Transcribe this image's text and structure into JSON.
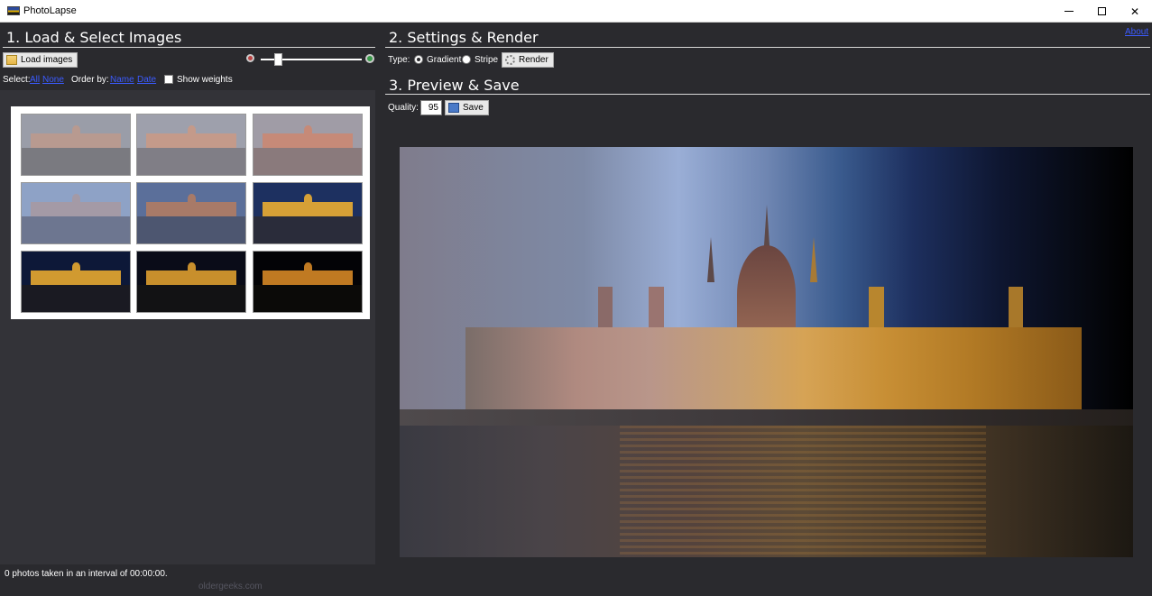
{
  "window": {
    "title": "PhotoLapse"
  },
  "sections": {
    "load": {
      "title": "1. Load & Select Images"
    },
    "settings": {
      "title": "2. Settings & Render"
    },
    "preview": {
      "title": "3. Preview & Save"
    }
  },
  "about_link": "About",
  "load_panel": {
    "load_button": "Load images",
    "select_label": "Select:",
    "select_all": "All",
    "select_none": "None",
    "order_label": "Order by:",
    "order_name": "Name",
    "order_date": "Date",
    "show_weights_label": "Show weights",
    "show_weights_checked": false
  },
  "settings_panel": {
    "type_label": "Type:",
    "options": [
      "Gradient",
      "Stripe"
    ],
    "selected": "Gradient",
    "render_button": "Render"
  },
  "preview_panel": {
    "quality_label": "Quality:",
    "quality_value": "95",
    "save_button": "Save"
  },
  "thumbnails": [
    {
      "sky": "#9a9da8",
      "bld": "#b89a90",
      "water": "#7a7a80"
    },
    {
      "sky": "#9ea0ac",
      "bld": "#c49a8a",
      "water": "#807e86"
    },
    {
      "sky": "#a09ca6",
      "bld": "#c68a78",
      "water": "#8a7a7c"
    },
    {
      "sky": "#8ea2c6",
      "bld": "#a49aa6",
      "water": "#6d7690"
    },
    {
      "sky": "#5b6f9a",
      "bld": "#a87a68",
      "water": "#4d5670"
    },
    {
      "sky": "#1d3060",
      "bld": "#d6a036",
      "water": "#2a2c3a"
    },
    {
      "sky": "#0d1838",
      "bld": "#d19a30",
      "water": "#1a1a22"
    },
    {
      "sky": "#0a0c18",
      "bld": "#c88f2c",
      "water": "#121214"
    },
    {
      "sky": "#030306",
      "bld": "#c07a22",
      "water": "#0b0a08"
    }
  ],
  "status": "0 photos taken in an interval of 00:00:00.",
  "watermark": "oldergeeks.com"
}
